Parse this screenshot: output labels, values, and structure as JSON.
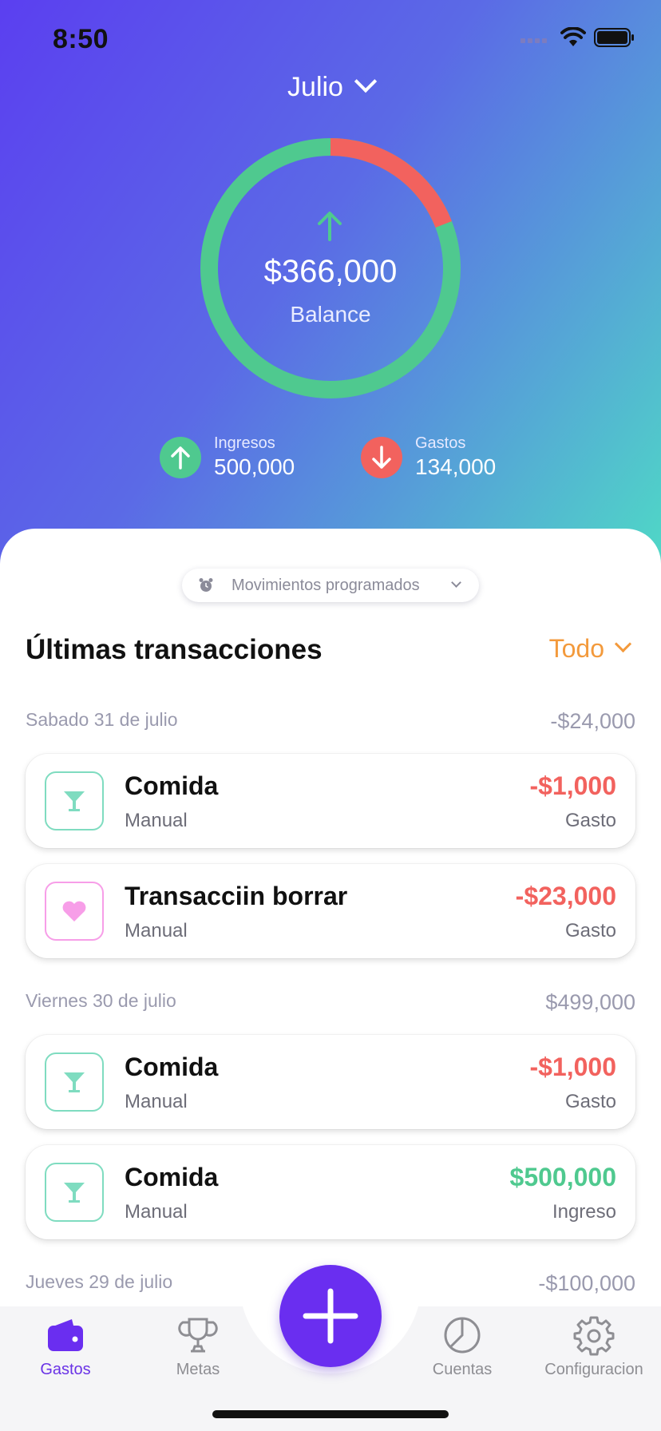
{
  "status_bar": {
    "time": "8:50"
  },
  "header": {
    "month": "Julio",
    "balance_amount": "$366,000",
    "balance_label": "Balance",
    "income_label": "Ingresos",
    "income_value": "500,000",
    "expense_label": "Gastos",
    "expense_value": "134,000",
    "income_color": "#4fc98f",
    "expense_color": "#f2625e"
  },
  "scheduled": {
    "label": "Movimientos programados"
  },
  "transactions_section": {
    "title": "Últimas transacciones",
    "filter": "Todo"
  },
  "days": [
    {
      "date": "Sabado 31 de julio",
      "total": "-$24,000",
      "items": [
        {
          "title": "Comida",
          "source": "Manual",
          "amount": "-$1,000",
          "type": "Gasto",
          "icon": "cocktail-icon",
          "sign": "neg"
        },
        {
          "title": "Transacciin borrar",
          "source": "Manual",
          "amount": "-$23,000",
          "type": "Gasto",
          "icon": "heart-icon",
          "sign": "neg"
        }
      ]
    },
    {
      "date": "Viernes 30 de julio",
      "total": "$499,000",
      "items": [
        {
          "title": "Comida",
          "source": "Manual",
          "amount": "-$1,000",
          "type": "Gasto",
          "icon": "cocktail-icon",
          "sign": "neg"
        },
        {
          "title": "Comida",
          "source": "Manual",
          "amount": "$500,000",
          "type": "Ingreso",
          "icon": "cocktail-icon",
          "sign": "pos"
        }
      ]
    },
    {
      "date": "Jueves 29 de julio",
      "total": "-$100,000",
      "items": []
    }
  ],
  "tabbar": {
    "tabs": [
      {
        "label": "Gastos",
        "icon": "wallet-icon",
        "active": true
      },
      {
        "label": "Metas",
        "icon": "trophy-icon",
        "active": false
      },
      {
        "label": "Cuentas",
        "icon": "pie-chart-icon",
        "active": false
      },
      {
        "label": "Configuracion",
        "icon": "gear-icon",
        "active": false
      }
    ],
    "accent": "#6a2ef0"
  }
}
